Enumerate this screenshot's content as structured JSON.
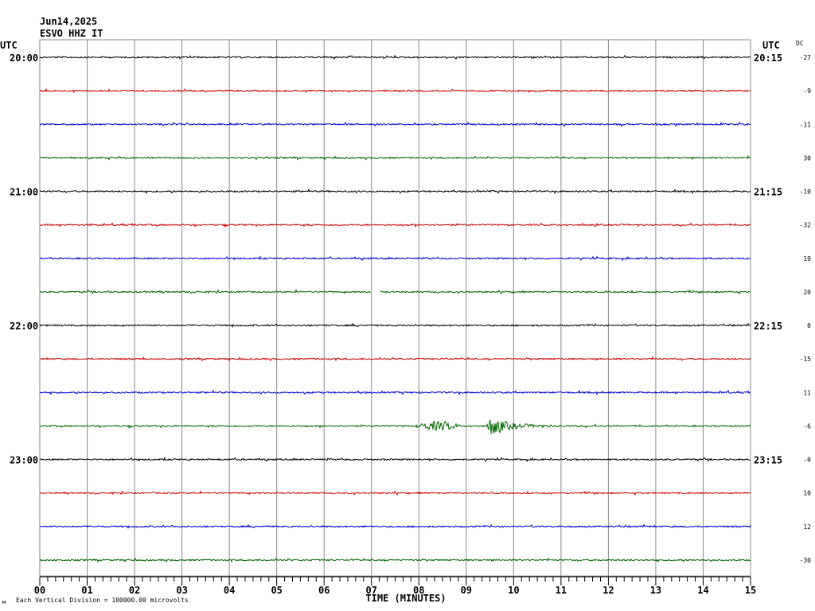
{
  "header": {
    "date": "Jun14,2025",
    "station": "ESVO HHZ IT",
    "utc_left": "UTC",
    "utc_right": "UTC",
    "dc_header": "DC"
  },
  "footer": {
    "xlabel": "TIME (MINUTES)",
    "scale_note": "Each Vertical Division = 100000.00 microvolts"
  },
  "colors": {
    "trace_cycle": [
      "#000000",
      "#cc0000",
      "#0000cc",
      "#006600"
    ],
    "grid": "#888888"
  },
  "chart_data": {
    "type": "line",
    "title": "",
    "xlabel": "TIME (MINUTES)",
    "xlim": [
      0,
      15
    ],
    "x_ticks": [
      "00",
      "01",
      "02",
      "03",
      "04",
      "05",
      "06",
      "07",
      "08",
      "09",
      "10",
      "11",
      "12",
      "13",
      "14",
      "15"
    ],
    "rows": [
      {
        "left": "20:00",
        "right": "20:15",
        "dc": "-27",
        "color": "#000000"
      },
      {
        "left": "",
        "right": "",
        "dc": "-9",
        "color": "#cc0000"
      },
      {
        "left": "",
        "right": "",
        "dc": "-11",
        "color": "#0000cc"
      },
      {
        "left": "",
        "right": "",
        "dc": "30",
        "color": "#006600"
      },
      {
        "left": "21:00",
        "right": "21:15",
        "dc": "-10",
        "color": "#000000"
      },
      {
        "left": "",
        "right": "",
        "dc": "-32",
        "color": "#cc0000"
      },
      {
        "left": "",
        "right": "",
        "dc": "19",
        "color": "#0000cc"
      },
      {
        "left": "",
        "right": "",
        "dc": "20",
        "color": "#006600"
      },
      {
        "left": "22:00",
        "right": "22:15",
        "dc": "0",
        "color": "#000000"
      },
      {
        "left": "",
        "right": "",
        "dc": "-15",
        "color": "#cc0000"
      },
      {
        "left": "",
        "right": "",
        "dc": "11",
        "color": "#0000cc"
      },
      {
        "left": "",
        "right": "",
        "dc": "-6",
        "color": "#006600"
      },
      {
        "left": "23:00",
        "right": "23:15",
        "dc": "-0",
        "color": "#000000"
      },
      {
        "left": "",
        "right": "",
        "dc": "10",
        "color": "#cc0000"
      },
      {
        "left": "",
        "right": "",
        "dc": "12",
        "color": "#0000cc"
      },
      {
        "left": "",
        "right": "",
        "dc": "-30",
        "color": "#006600"
      }
    ],
    "events": [
      {
        "row": 11,
        "start_min": 7.9,
        "end_min": 8.9,
        "amplitude": "small"
      },
      {
        "row": 11,
        "start_min": 9.45,
        "end_min": 11.0,
        "amplitude": "large"
      }
    ],
    "gaps": [
      {
        "row": 7,
        "start_min": 7.0,
        "end_min": 7.18
      }
    ],
    "grid": true
  }
}
